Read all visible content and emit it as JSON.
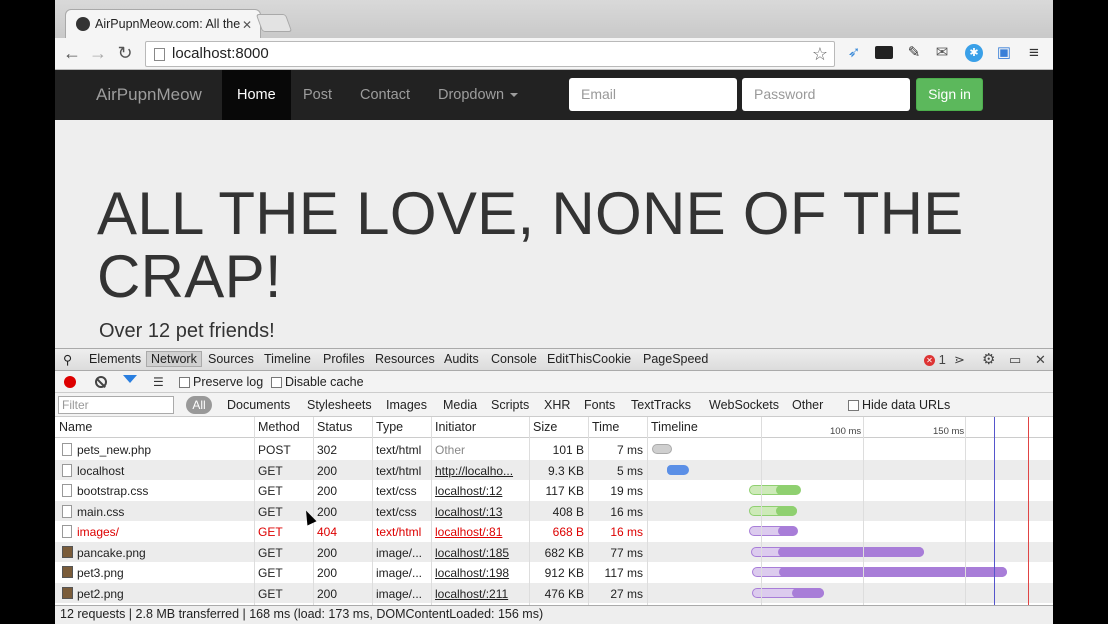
{
  "browser": {
    "tab_title": "AirPupnMeow.com: All the",
    "url": "localhost:8000"
  },
  "site": {
    "brand": "AirPupnMeow",
    "nav": [
      "Home",
      "Post",
      "Contact",
      "Dropdown"
    ],
    "email_placeholder": "Email",
    "password_placeholder": "Password",
    "signin_label": "Sign in",
    "hero": "ALL THE LOVE, NONE OF THE CRAP!",
    "subtitle": "Over 12 pet friends!"
  },
  "devtools": {
    "tabs": [
      "Elements",
      "Network",
      "Sources",
      "Timeline",
      "Profiles",
      "Resources",
      "Audits",
      "Console",
      "EditThisCookie",
      "PageSpeed"
    ],
    "selected_tab": "Network",
    "error_count": "1",
    "preserve_log": "Preserve log",
    "disable_cache": "Disable cache",
    "filter_placeholder": "Filter",
    "type_filters": [
      "All",
      "Documents",
      "Stylesheets",
      "Images",
      "Media",
      "Scripts",
      "XHR",
      "Fonts",
      "TextTracks",
      "WebSockets",
      "Other"
    ],
    "hide_data_urls": "Hide data URLs",
    "columns": [
      "Name",
      "Method",
      "Status",
      "Type",
      "Initiator",
      "Size",
      "Time",
      "Timeline"
    ],
    "timeline_labels": [
      "100 ms",
      "150 ms"
    ],
    "rows": [
      {
        "name": "pets_new.php",
        "method": "POST",
        "status": "302",
        "type": "text/html",
        "initiator": "Other",
        "size": "101 B",
        "time": "7 ms",
        "error": false
      },
      {
        "name": "localhost",
        "method": "GET",
        "status": "200",
        "type": "text/html",
        "initiator": "http://localho...",
        "size": "9.3 KB",
        "time": "5 ms",
        "error": false
      },
      {
        "name": "bootstrap.css",
        "method": "GET",
        "status": "200",
        "type": "text/css",
        "initiator": "localhost/:12",
        "size": "117 KB",
        "time": "19 ms",
        "error": false
      },
      {
        "name": "main.css",
        "method": "GET",
        "status": "200",
        "type": "text/css",
        "initiator": "localhost/:13",
        "size": "408 B",
        "time": "16 ms",
        "error": false
      },
      {
        "name": "images/",
        "method": "GET",
        "status": "404",
        "type": "text/html",
        "initiator": "localhost/:81",
        "size": "668 B",
        "time": "16 ms",
        "error": true
      },
      {
        "name": "pancake.png",
        "method": "GET",
        "status": "200",
        "type": "image/...",
        "initiator": "localhost/:185",
        "size": "682 KB",
        "time": "77 ms",
        "error": false
      },
      {
        "name": "pet3.png",
        "method": "GET",
        "status": "200",
        "type": "image/...",
        "initiator": "localhost/:198",
        "size": "912 KB",
        "time": "117 ms",
        "error": false
      },
      {
        "name": "pet2.png",
        "method": "GET",
        "status": "200",
        "type": "image/...",
        "initiator": "localhost/:211",
        "size": "476 KB",
        "time": "27 ms",
        "error": false
      }
    ],
    "status_bar": "12 requests | 2.8 MB transferred | 168 ms (load: 173 ms, DOMContentLoaded: 156 ms)"
  }
}
